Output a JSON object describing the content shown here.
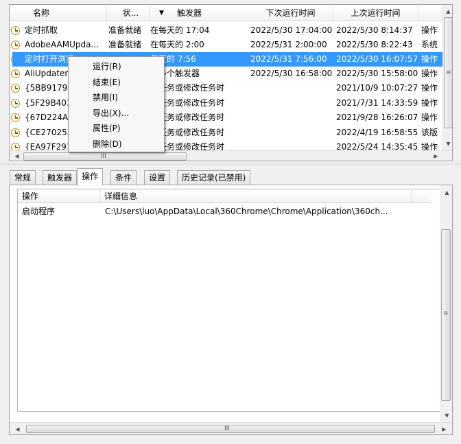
{
  "columns": {
    "name": "名称",
    "status": "状...",
    "sort_arrow": "▼",
    "trigger": "触发器",
    "next_run": "下次运行时间",
    "last_run": "上次运行时间"
  },
  "tasks": [
    {
      "name": "定时抓取",
      "status": "准备就绪",
      "trigger": "在每天的 17:04",
      "next": "2022/5/30 17:04:00",
      "last": "2022/5/30 8:14:37",
      "author": "操作"
    },
    {
      "name": "AdobeAAMUpda...",
      "status": "准备就绪",
      "trigger": "在每天的 2:00",
      "next": "2022/5/31 2:00:00",
      "last": "2022/5/30 8:22:43",
      "author": "系统"
    },
    {
      "name": "定时打开浏览",
      "status": "",
      "trigger": "每天的 7:56",
      "next": "2022/5/31 7:56:00",
      "last": "2022/5/30 16:07:57",
      "author": "操作"
    },
    {
      "name": "AliUpdater",
      "status": "",
      "trigger": "义多个触发器",
      "next": "2022/5/30 16:58:00",
      "last": "2022/5/30 15:58:00",
      "author": "操作"
    },
    {
      "name": "{5BB9179D",
      "status": "",
      "trigger": "建任务或修改任务时",
      "next": "",
      "last": "2021/10/9 10:07:27",
      "author": "操作"
    },
    {
      "name": "{5F29B403",
      "status": "",
      "trigger": "建任务或修改任务时",
      "next": "",
      "last": "2021/7/31 14:33:59",
      "author": "操作"
    },
    {
      "name": "{67D224A4",
      "status": "",
      "trigger": "建任务或修改任务时",
      "next": "",
      "last": "2021/9/28 16:26:07",
      "author": "操作"
    },
    {
      "name": "{CE270252",
      "status": "",
      "trigger": "建任务或修改任务时",
      "next": "",
      "last": "2022/4/19 16:58:55",
      "author": "该版"
    },
    {
      "name": "{EA97F291",
      "status": "",
      "trigger": "建任务或修改任务时",
      "next": "",
      "last": "2022/5/24 14:35:45",
      "author": "操作"
    }
  ],
  "selected_row": 2,
  "context_menu": [
    {
      "label": "运行(R)",
      "name": "menu-item-run"
    },
    {
      "label": "结束(E)",
      "name": "menu-item-end"
    },
    {
      "label": "禁用(I)",
      "name": "menu-item-disable"
    },
    {
      "label": "导出(X)...",
      "name": "menu-item-export"
    },
    {
      "label": "属性(P)",
      "name": "menu-item-properties"
    },
    {
      "label": "删除(D)",
      "name": "menu-item-delete"
    }
  ],
  "tabs": [
    {
      "label": "常规",
      "name": "tab-general"
    },
    {
      "label": "触发器",
      "name": "tab-triggers"
    },
    {
      "label": "操作",
      "name": "tab-actions"
    },
    {
      "label": "条件",
      "name": "tab-conditions"
    },
    {
      "label": "设置",
      "name": "tab-settings"
    },
    {
      "label": "历史记录(已禁用)",
      "name": "tab-history"
    }
  ],
  "active_tab": 2,
  "actions_table": {
    "headers": [
      "操作",
      "详细信息"
    ],
    "rows": [
      [
        "启动程序",
        "C:\\Users\\luo\\AppData\\Local\\360Chrome\\Chrome\\Application\\360ch..."
      ]
    ]
  },
  "scroll_glyphs": {
    "up": "▲",
    "down": "▼",
    "left": "◀",
    "right": "▶",
    "grip_h": "III",
    "grip_v": "≡"
  },
  "colors": {
    "selection": "#3399ff",
    "clock_icon": "#b88a2f"
  }
}
